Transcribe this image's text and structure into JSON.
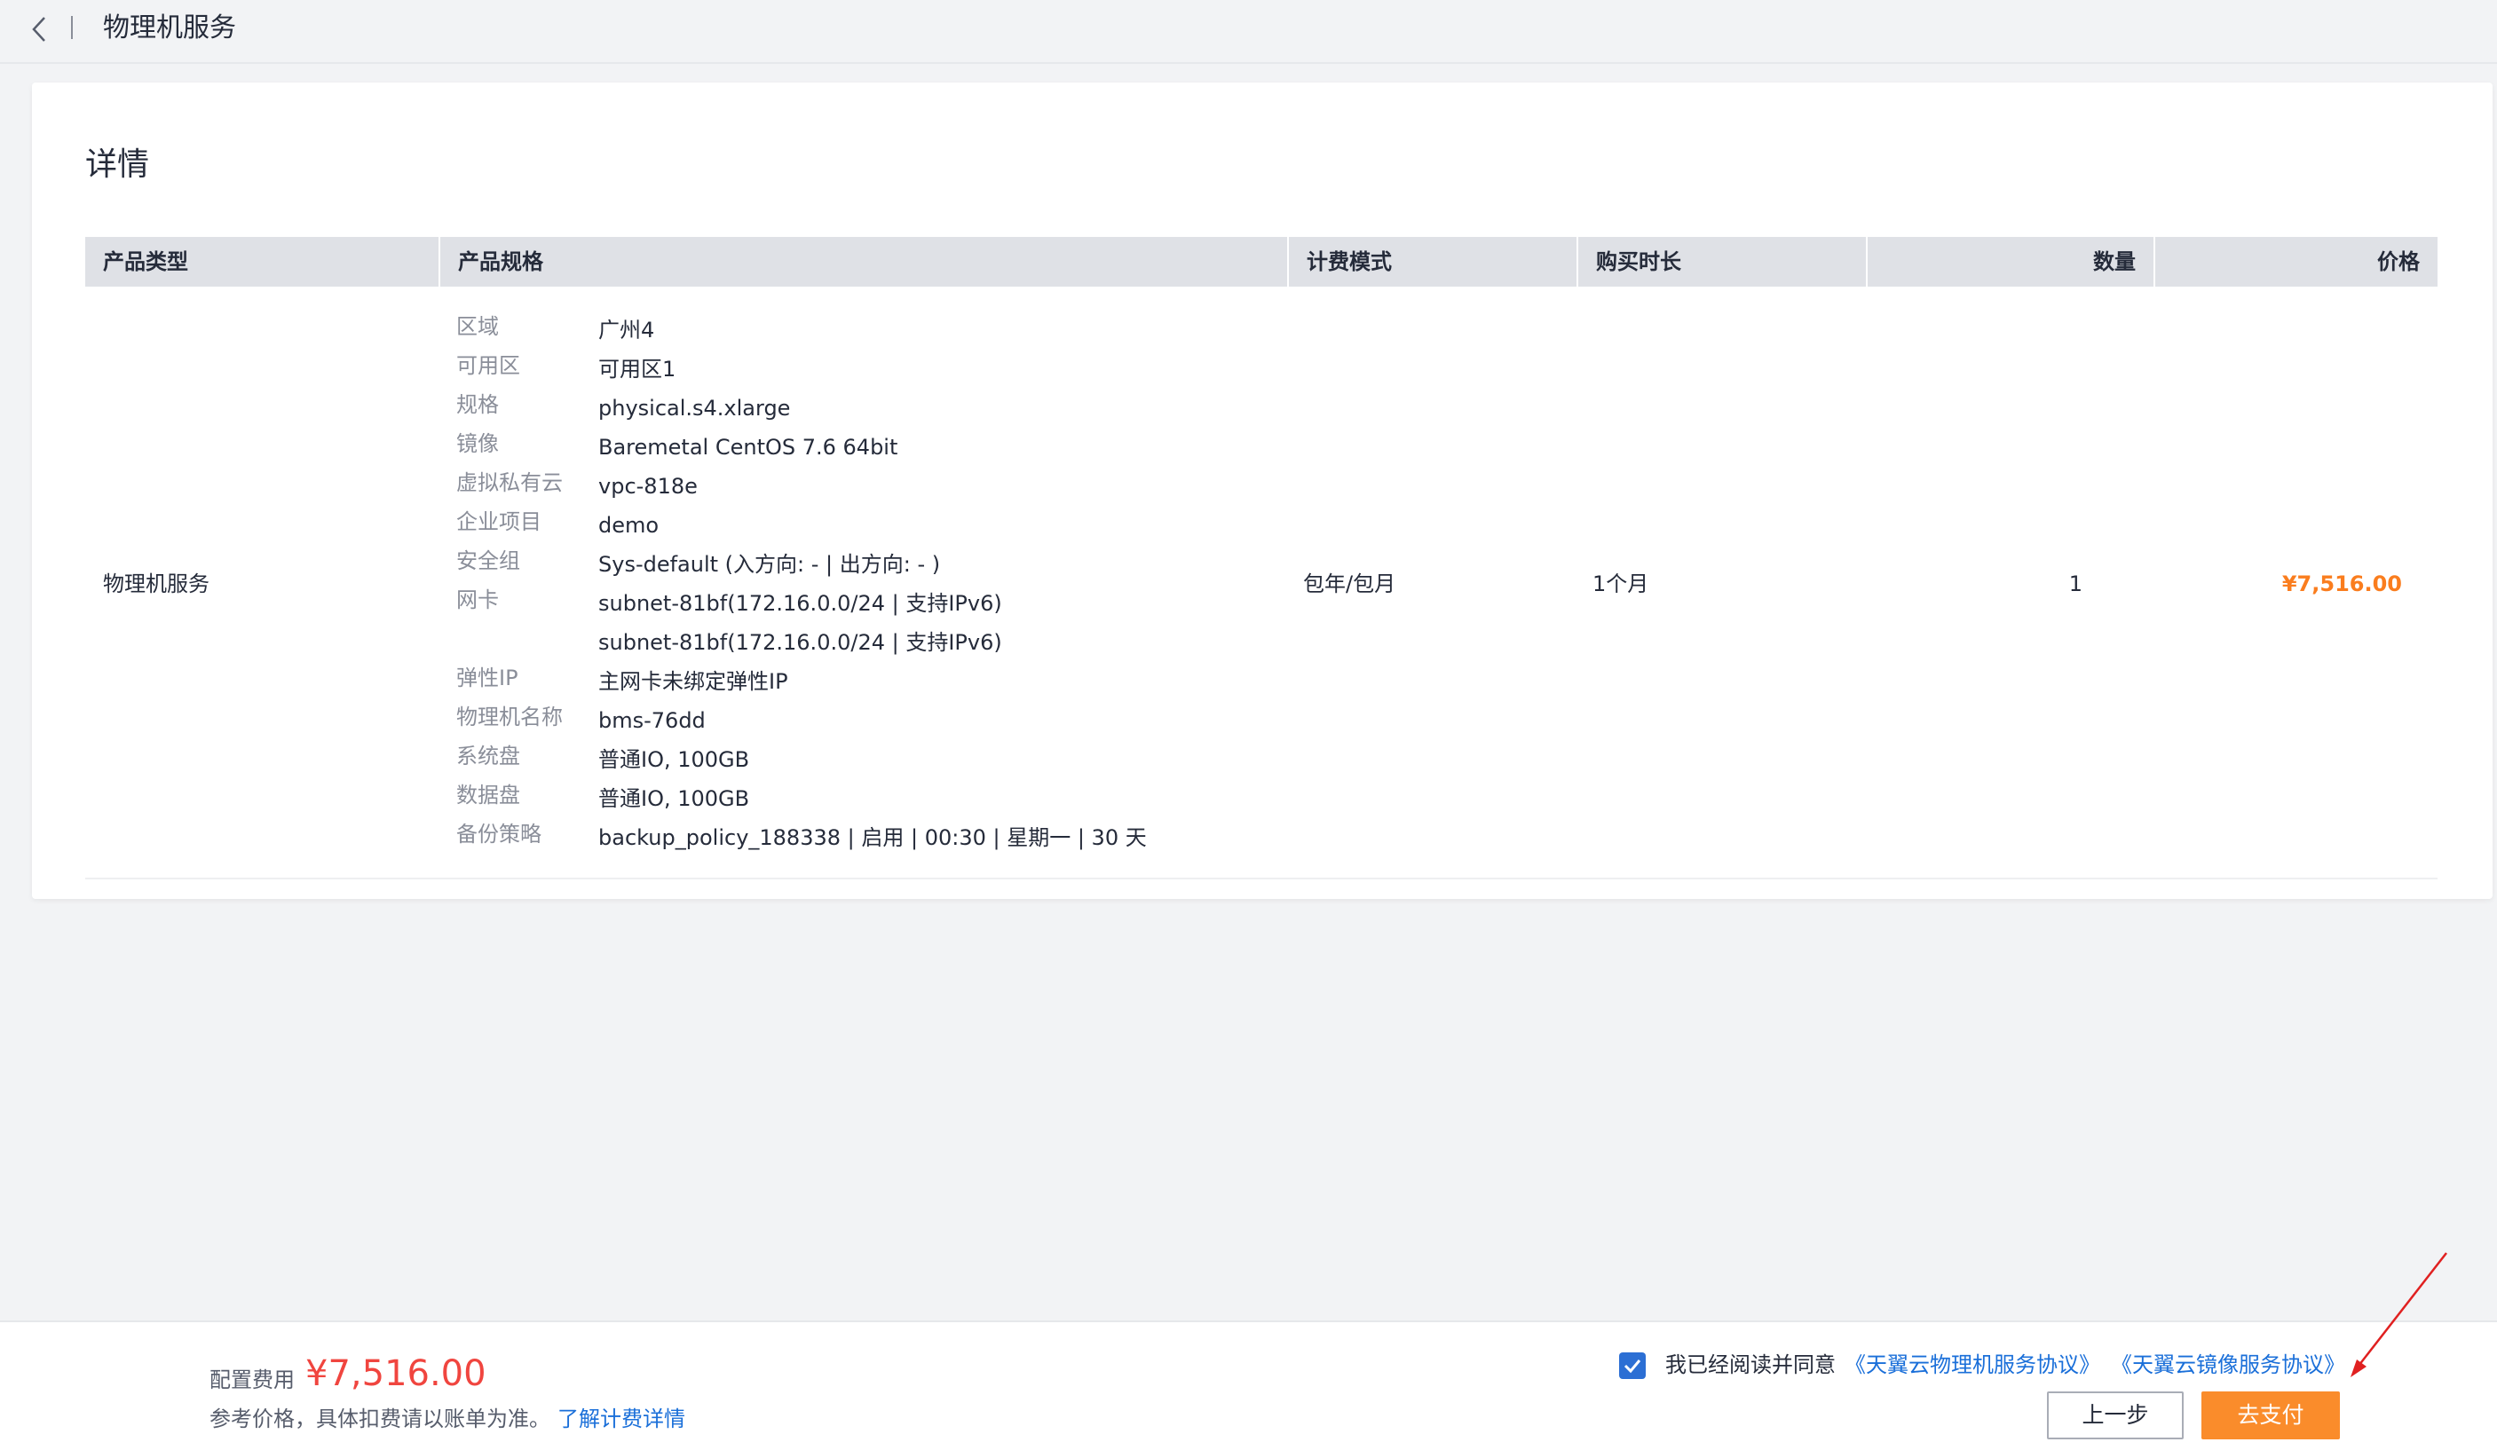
{
  "header": {
    "title": "物理机服务"
  },
  "details": {
    "title": "详情",
    "columns": [
      "产品类型",
      "产品规格",
      "计费模式",
      "购买时长",
      "数量",
      "价格"
    ],
    "row": {
      "product_type": "物理机服务",
      "billing_mode": "包年/包月",
      "duration": "1个月",
      "quantity": "1",
      "price": "¥7,516.00"
    },
    "specs": [
      {
        "label": "区域",
        "values": [
          "广州4"
        ]
      },
      {
        "label": "可用区",
        "values": [
          "可用区1"
        ]
      },
      {
        "label": "规格",
        "values": [
          "physical.s4.xlarge"
        ]
      },
      {
        "label": "镜像",
        "values": [
          "Baremetal CentOS 7.6 64bit"
        ]
      },
      {
        "label": "虚拟私有云",
        "values": [
          "vpc-818e"
        ]
      },
      {
        "label": "企业项目",
        "values": [
          "demo"
        ]
      },
      {
        "label": "安全组",
        "values": [
          "Sys-default (入方向: - | 出方向: - )"
        ]
      },
      {
        "label": "网卡",
        "values": [
          "subnet-81bf(172.16.0.0/24 | 支持IPv6)",
          "subnet-81bf(172.16.0.0/24 | 支持IPv6)"
        ]
      },
      {
        "label": "弹性IP",
        "values": [
          "主网卡未绑定弹性IP"
        ]
      },
      {
        "label": "物理机名称",
        "values": [
          "bms-76dd"
        ]
      },
      {
        "label": "系统盘",
        "values": [
          "普通IO, 100GB"
        ]
      },
      {
        "label": "数据盘",
        "values": [
          "普通IO, 100GB"
        ]
      },
      {
        "label": "备份策略",
        "values": [
          "backup_policy_188338 | 启用 | 00:30 | 星期一 | 30 天"
        ]
      }
    ]
  },
  "footer": {
    "fee_label": "配置费用",
    "fee_amount": "¥7,516.00",
    "fee_note": "参考价格，具体扣费请以账单为准。",
    "fee_link": "了解计费详情",
    "agree_checked": true,
    "agree_text": "我已经阅读并同意",
    "agree_link_1": "《天翼云物理机服务协议》",
    "agree_link_2": "《天翼云镜像服务协议》",
    "prev_button": "上一步",
    "pay_button": "去支付"
  },
  "colors": {
    "accent_blue": "#1a6fd9",
    "price_orange": "#fa7d1e",
    "fee_red": "#f0453f",
    "pay_button": "#fa8c2b",
    "annotation_arrow": "#e02020"
  },
  "icons": [
    "chevron-left-icon",
    "checkbox-checked-icon",
    "annotation-arrow"
  ]
}
